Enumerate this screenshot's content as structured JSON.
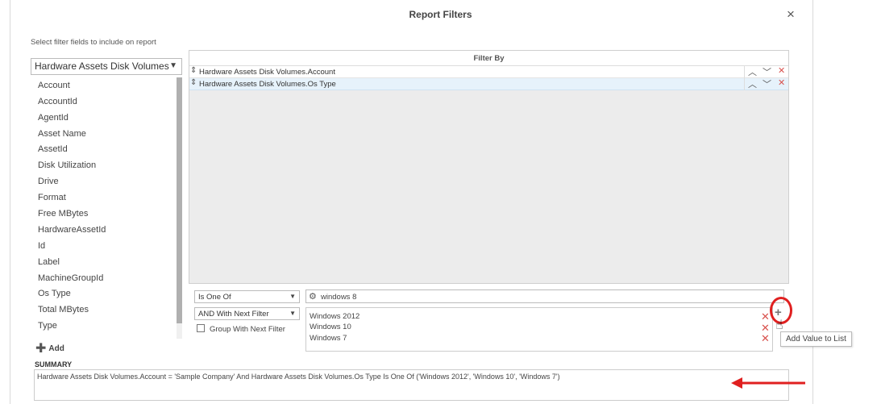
{
  "dialog": {
    "title": "Report Filters",
    "close_icon": "×"
  },
  "left": {
    "hint": "Select filter fields to include on report",
    "table_select": "Hardware Assets Disk Volumes",
    "fields": [
      "Account",
      "AccountId",
      "AgentId",
      "Asset Name",
      "AssetId",
      "Disk Utilization",
      "Drive",
      "Format",
      "Free MBytes",
      "HardwareAssetId",
      "Id",
      "Label",
      "MachineGroupId",
      "Os Type",
      "Total MBytes",
      "Type"
    ],
    "add_label": "Add"
  },
  "filter_by": {
    "header": "Filter By",
    "rows": [
      "Hardware Assets Disk Volumes.Account",
      "Hardware Assets Disk Volumes.Os Type"
    ]
  },
  "editor": {
    "operator": "Is One Of",
    "conjunction": "AND With Next Filter",
    "group_label": "Group With Next Filter",
    "value_input": "windows 8",
    "values": [
      "Windows 2012",
      "Windows 10",
      "Windows 7"
    ],
    "tooltip": "Add Value to List"
  },
  "summary": {
    "label": "SUMMARY",
    "text": "Hardware Assets Disk Volumes.Account = 'Sample Company' And Hardware Assets Disk Volumes.Os Type Is One Of ('Windows 2012', 'Windows 10', 'Windows 7')"
  },
  "colors": {
    "accent_red": "#e02020",
    "delete_red": "#d9534f",
    "selected_row": "#e6f2fb"
  }
}
